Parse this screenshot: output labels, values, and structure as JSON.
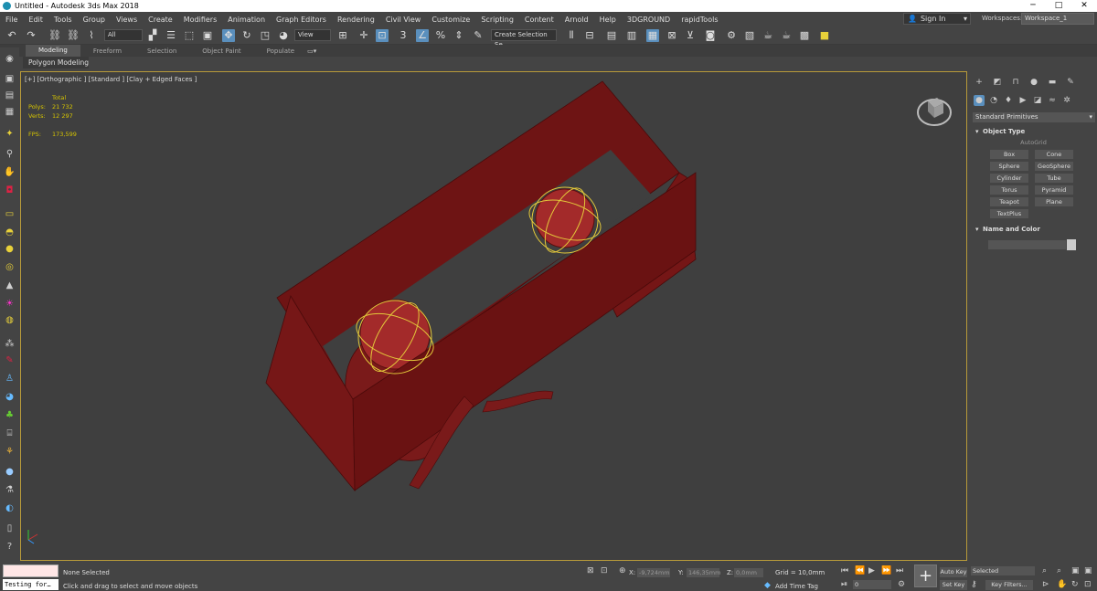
{
  "title_bar": {
    "title": "Untitled - Autodesk 3ds Max 2018",
    "minimize": "─",
    "maximize": "□",
    "close": "✕"
  },
  "menu": [
    "File",
    "Edit",
    "Tools",
    "Group",
    "Views",
    "Create",
    "Modifiers",
    "Animation",
    "Graph Editors",
    "Rendering",
    "Civil View",
    "Customize",
    "Scripting",
    "Content",
    "Arnold",
    "Help",
    "3DGROUND",
    "rapidTools"
  ],
  "account": {
    "sign_in": "Sign In",
    "workspaces_label": "Workspaces:",
    "workspace": "Workspace_1"
  },
  "toolbar": {
    "filter": "All",
    "ref_coord": "View",
    "selection_set": "Create Selection Se"
  },
  "ribbon": {
    "tabs": [
      "Modeling",
      "Freeform",
      "Selection",
      "Object Paint",
      "Populate"
    ],
    "active_tab": "Modeling",
    "sub": "Polygon Modeling"
  },
  "viewport": {
    "label": "[+] [Orthographic ] [Standard ] [Clay + Edged Faces ]",
    "stats": {
      "header": "Total",
      "polys_label": "Polys:",
      "polys": "21 732",
      "verts_label": "Verts:",
      "verts": "12 297",
      "fps_label": "FPS:",
      "fps": "173,599"
    }
  },
  "command_panel": {
    "category": "Standard Primitives",
    "object_type_title": "Object Type",
    "autogrid": "AutoGrid",
    "primitives": [
      "Box",
      "Cone",
      "Sphere",
      "GeoSphere",
      "Cylinder",
      "Tube",
      "Torus",
      "Pyramid",
      "Teapot",
      "Plane",
      "TextPlus"
    ],
    "name_color_title": "Name and Color"
  },
  "status_bar": {
    "maxscript_text": "Testing for…",
    "selection": "None Selected",
    "prompt": "Click and drag to select and move objects",
    "x_label": "X:",
    "x": "-9,724mm",
    "y_label": "Y:",
    "y": "146,35mm",
    "z_label": "Z:",
    "z": "0,0mm",
    "grid": "Grid = 10,0mm",
    "add_time_tag": "Add Time Tag",
    "frame": "0",
    "auto_key": "Auto Key",
    "set_key": "Set Key",
    "key_mode": "Selected",
    "key_filters": "Key Filters..."
  },
  "colors": {
    "accent_blue": "#5a8fbd",
    "viewport_border": "#b89a3a",
    "stats_yellow": "#d6c400",
    "object_red": "#6e1212"
  }
}
